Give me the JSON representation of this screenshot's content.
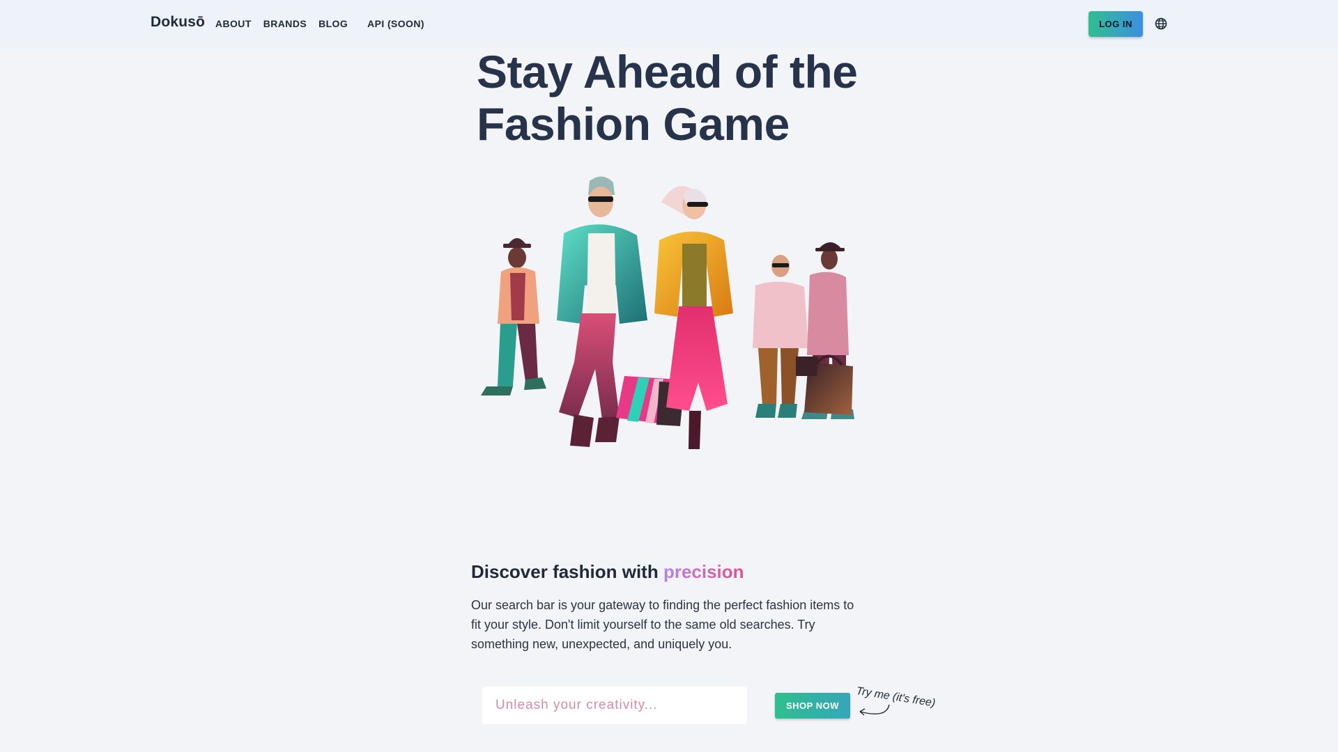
{
  "nav": {
    "brand": "Dokusō",
    "links": [
      {
        "label": "ABOUT"
      },
      {
        "label": "BRANDS"
      },
      {
        "label": "BLOG"
      },
      {
        "label": "API (SOON)"
      }
    ],
    "login_label": "LOG IN",
    "language_icon": "globe-icon"
  },
  "hero": {
    "title_line1": "Stay Ahead of the",
    "title_line2": "Fashion Game",
    "image": "illustration-of-five-stylish-people-walking-with-shopping-bags"
  },
  "discover": {
    "title_prefix": "Discover fashion with ",
    "title_highlight": "precision",
    "body": "Our search bar is your gateway to finding the perfect fashion items to fit your style. Don't limit yourself to the same old searches. Try something new, unexpected, and uniquely you."
  },
  "search": {
    "placeholder": "Unleash your creativity...",
    "value": ""
  },
  "cta": {
    "shop_label": "SHOP NOW",
    "hint": "Try me (it's free)"
  },
  "colors": {
    "nav_bg": "#eef3f9",
    "page_bg": "#f2f4f7",
    "accent_green": "#2fbf8f",
    "accent_blue": "#3d8fe0",
    "precision_start": "#b583e6",
    "precision_end": "#e0508a",
    "title": "#26334a"
  }
}
